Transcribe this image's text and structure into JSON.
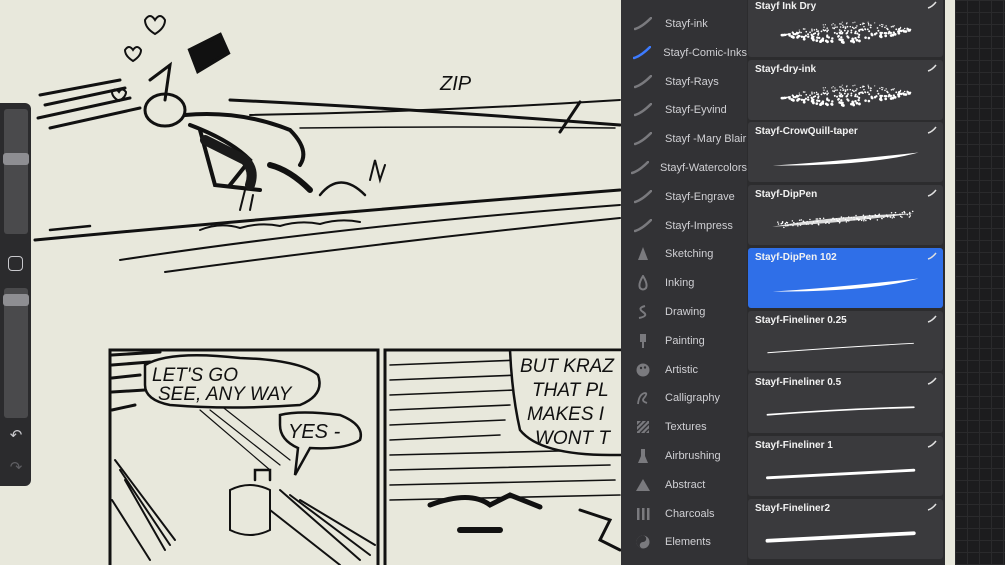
{
  "categories": [
    {
      "label": "Stayf-ink",
      "icon": "swoosh-icon",
      "active": false
    },
    {
      "label": "Stayf-Comic-Inks",
      "icon": "swoosh-icon",
      "active": true
    },
    {
      "label": "Stayf-Rays",
      "icon": "swoosh-icon",
      "active": false
    },
    {
      "label": "Stayf-Eyvind",
      "icon": "swoosh-icon",
      "active": false
    },
    {
      "label": "Stayf -Mary Blair",
      "icon": "swoosh-icon",
      "active": false
    },
    {
      "label": "Stayf-Watercolors",
      "icon": "swoosh-icon",
      "active": false
    },
    {
      "label": "Stayf-Engrave",
      "icon": "swoosh-icon",
      "active": false
    },
    {
      "label": "Stayf-Impress",
      "icon": "swoosh-icon",
      "active": false
    },
    {
      "label": "Sketching",
      "icon": "pencil-tip-icon",
      "active": false
    },
    {
      "label": "Inking",
      "icon": "ink-drop-icon",
      "active": false
    },
    {
      "label": "Drawing",
      "icon": "squiggle-icon",
      "active": false
    },
    {
      "label": "Painting",
      "icon": "paintbrush-icon",
      "active": false
    },
    {
      "label": "Artistic",
      "icon": "palette-icon",
      "active": false
    },
    {
      "label": "Calligraphy",
      "icon": "calligraphy-icon",
      "active": false
    },
    {
      "label": "Textures",
      "icon": "texture-icon",
      "active": false
    },
    {
      "label": "Airbrushing",
      "icon": "airbrush-icon",
      "active": false
    },
    {
      "label": "Abstract",
      "icon": "triangle-icon",
      "active": false
    },
    {
      "label": "Charcoals",
      "icon": "charcoal-icon",
      "active": false
    },
    {
      "label": "Elements",
      "icon": "yin-yang-icon",
      "active": false
    }
  ],
  "brushes": [
    {
      "name": "Stayf Ink Dry",
      "style": "grainy",
      "selected": false
    },
    {
      "name": "Stayf-dry-ink",
      "style": "grainy",
      "selected": false
    },
    {
      "name": "Stayf-CrowQuill-taper",
      "style": "taper",
      "selected": false
    },
    {
      "name": "Stayf-DipPen",
      "style": "grainy-taper",
      "selected": false
    },
    {
      "name": "Stayf-DipPen 102",
      "style": "taper",
      "selected": true
    },
    {
      "name": "Stayf-Fineliner 0.25",
      "style": "thin",
      "selected": false
    },
    {
      "name": "Stayf-Fineliner 0.5",
      "style": "medium",
      "selected": false
    },
    {
      "name": "Stayf-Fineliner 1",
      "style": "thick",
      "selected": false
    },
    {
      "name": "Stayf-Fineliner2",
      "style": "thicker",
      "selected": false
    }
  ],
  "comic_text": {
    "zip": "ZIP",
    "balloon_1_line_1": "LET'S GO",
    "balloon_1_line_2": "SEE, ANY WAY",
    "balloon_2": "YES -",
    "balloon_3_line_1": "BUT KRAZ",
    "balloon_3_line_2": "THAT PL",
    "balloon_3_line_3": "MAKES I",
    "balloon_3_line_4": "WONT T"
  },
  "colors": {
    "accent": "#2f6fe8",
    "canvas": "#e8e8dc",
    "panel": "#2c2c2e",
    "ink": "#111111"
  }
}
